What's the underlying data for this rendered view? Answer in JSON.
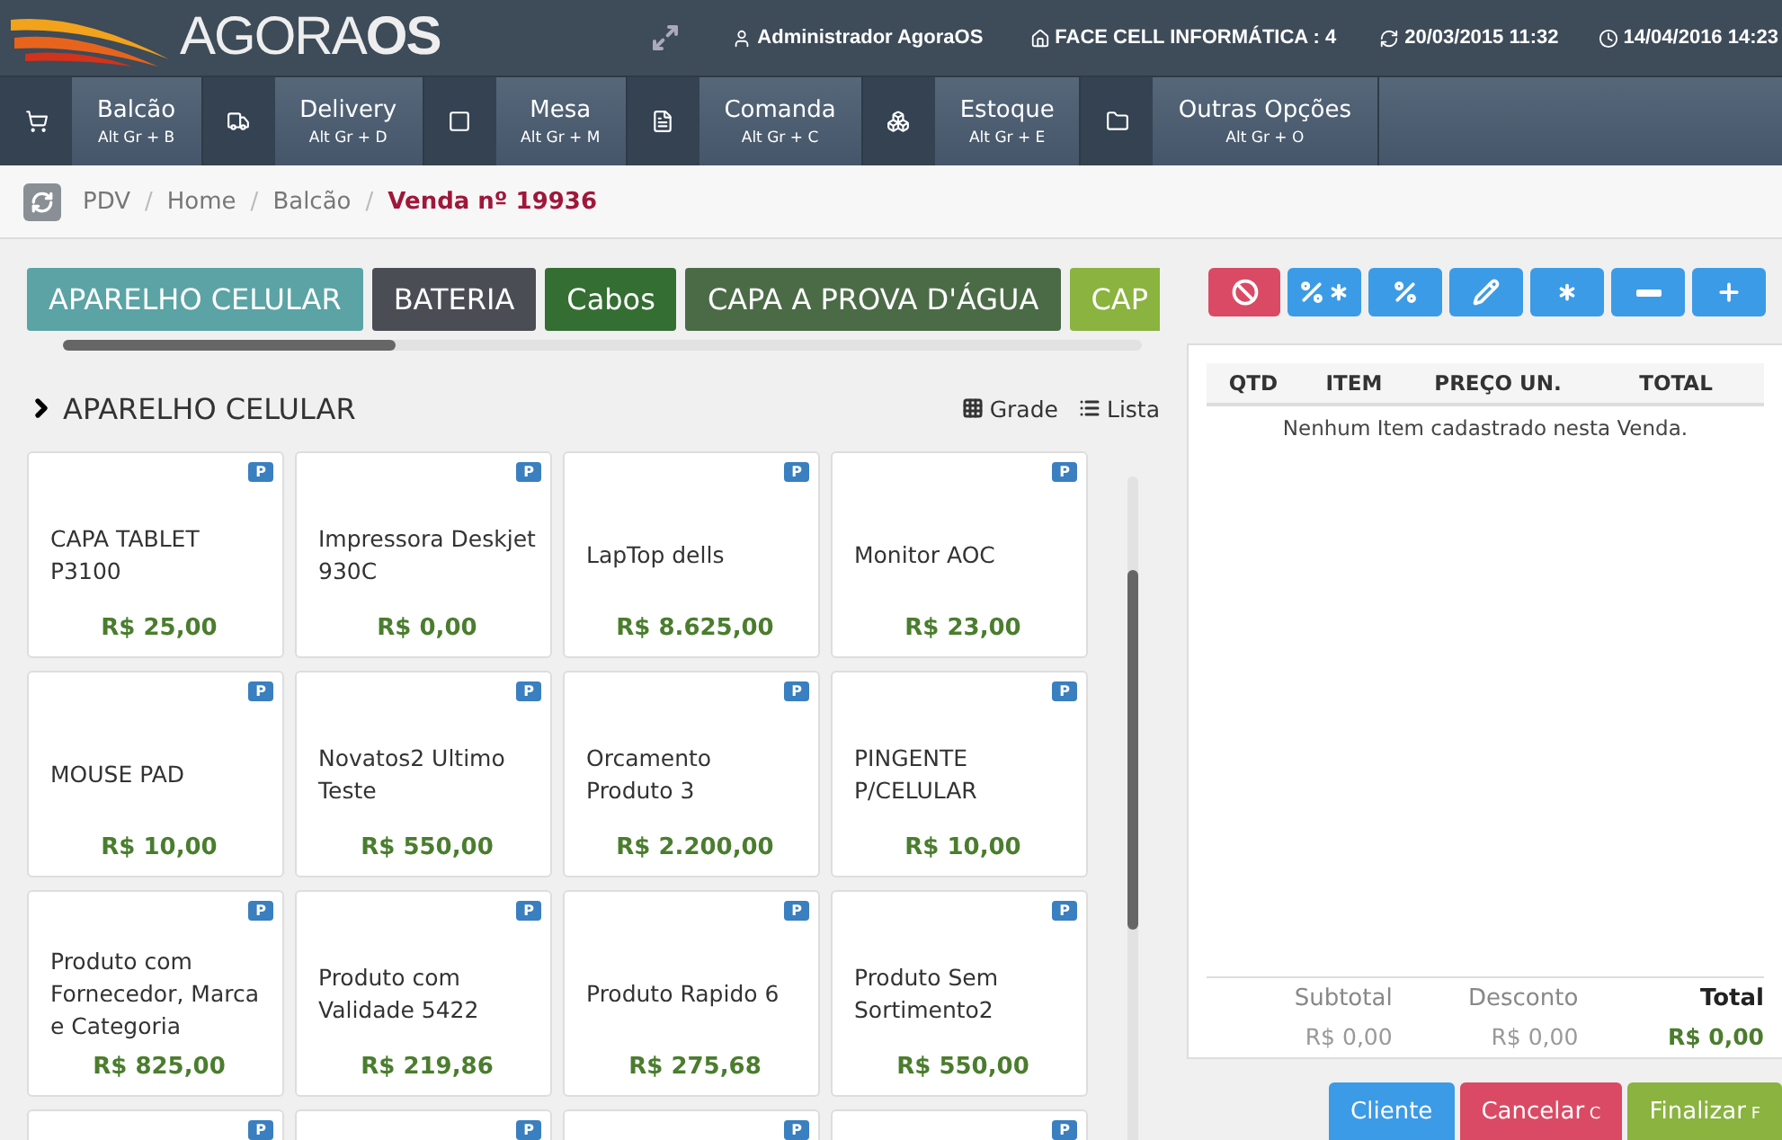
{
  "header": {
    "logo": {
      "prefix": "AGORA",
      "suffix": "OS"
    },
    "user": "Administrador AgoraOS",
    "company": "FACE CELL INFORMÁTICA : 4",
    "sync_date": "20/03/2015 11:32",
    "clock_date": "14/04/2016 14:23"
  },
  "nav": [
    {
      "kind": "cart",
      "label": "Balcão",
      "shortcut": "Alt Gr + B"
    },
    {
      "kind": "truck",
      "label": "Delivery",
      "shortcut": "Alt Gr + D"
    },
    {
      "kind": "square",
      "label": "Mesa",
      "shortcut": "Alt Gr + M"
    },
    {
      "kind": "file",
      "label": "Comanda",
      "shortcut": "Alt Gr + C"
    },
    {
      "kind": "boxes",
      "label": "Estoque",
      "shortcut": "Alt Gr + E"
    },
    {
      "kind": "folder",
      "label": "Outras Opções",
      "shortcut": "Alt Gr + O"
    }
  ],
  "breadcrumb": [
    {
      "label": "PDV",
      "current": false
    },
    {
      "separator": "/",
      "label": "Home",
      "current": false
    },
    {
      "separator": "/",
      "label": "Balcão",
      "current": false
    },
    {
      "separator": "/",
      "label": "Venda nº 19936",
      "current": true
    }
  ],
  "categories": [
    {
      "label": "APARELHO CELULAR",
      "color": "#5ba3a5"
    },
    {
      "label": "BATERIA",
      "color": "#4a4d54"
    },
    {
      "label": "Cabos",
      "color": "#346e32"
    },
    {
      "label": "CAPA A PROVA D'ÁGUA",
      "color": "#4b6b47"
    },
    {
      "label": "CAP",
      "color": "#8ab33f"
    }
  ],
  "section_title": "APARELHO CELULAR",
  "view_modes": [
    {
      "kind": "grid",
      "label": "Grade"
    },
    {
      "kind": "list",
      "label": "Lista"
    }
  ],
  "products": [
    {
      "name": "CAPA TABLET P3100",
      "price": "R$ 25,00",
      "badge": "P"
    },
    {
      "name": "Impressora Deskjet 930C",
      "price": "R$ 0,00",
      "badge": "P"
    },
    {
      "name": "LapTop dells",
      "price": "R$ 8.625,00",
      "badge": "P"
    },
    {
      "name": "Monitor AOC",
      "price": "R$ 23,00",
      "badge": "P"
    },
    {
      "name": "MOUSE PAD",
      "price": "R$ 10,00",
      "badge": "P"
    },
    {
      "name": "Novatos2 Ultimo Teste",
      "price": "R$ 550,00",
      "badge": "P"
    },
    {
      "name": "Orcamento Produto 3",
      "price": "R$ 2.200,00",
      "badge": "P"
    },
    {
      "name": "PINGENTE P/CELULAR",
      "price": "R$ 10,00",
      "badge": "P"
    },
    {
      "name": "Produto com Fornecedor, Marca e Categoria",
      "price": "R$ 825,00",
      "badge": "P"
    },
    {
      "name": "Produto com Validade 5422",
      "price": "R$ 219,86",
      "badge": "P"
    },
    {
      "name": "Produto Rapido 6",
      "price": "R$ 275,68",
      "badge": "P"
    },
    {
      "name": "Produto Sem Sortimento2",
      "price": "R$ 550,00",
      "badge": "P"
    },
    {
      "badge": "P"
    },
    {
      "badge": "P"
    },
    {
      "badge": "P"
    },
    {
      "badge": "P"
    }
  ],
  "actions": [
    {
      "kind": "cancel"
    },
    {
      "kind": "percent-all"
    },
    {
      "kind": "percent"
    },
    {
      "kind": "edit"
    },
    {
      "kind": "asterisk"
    },
    {
      "kind": "minus"
    },
    {
      "kind": "plus"
    }
  ],
  "table": {
    "columns": [
      "QTD",
      "ITEM",
      "PREÇO UN.",
      "TOTAL"
    ],
    "empty_message": "Nenhum Item cadastrado nesta Venda."
  },
  "totals": [
    {
      "label": "Subtotal",
      "value": "R$ 0,00",
      "emphasis": false
    },
    {
      "label": "Desconto",
      "value": "R$ 0,00",
      "emphasis": false
    },
    {
      "label": "Total",
      "value": "R$ 0,00",
      "emphasis": true
    }
  ],
  "buttons": [
    {
      "kind": "info",
      "label": "Cliente"
    },
    {
      "kind": "danger",
      "label": "Cancelar",
      "hotkey": "C"
    },
    {
      "kind": "success",
      "label": "Finalizar",
      "hotkey": "F"
    }
  ]
}
